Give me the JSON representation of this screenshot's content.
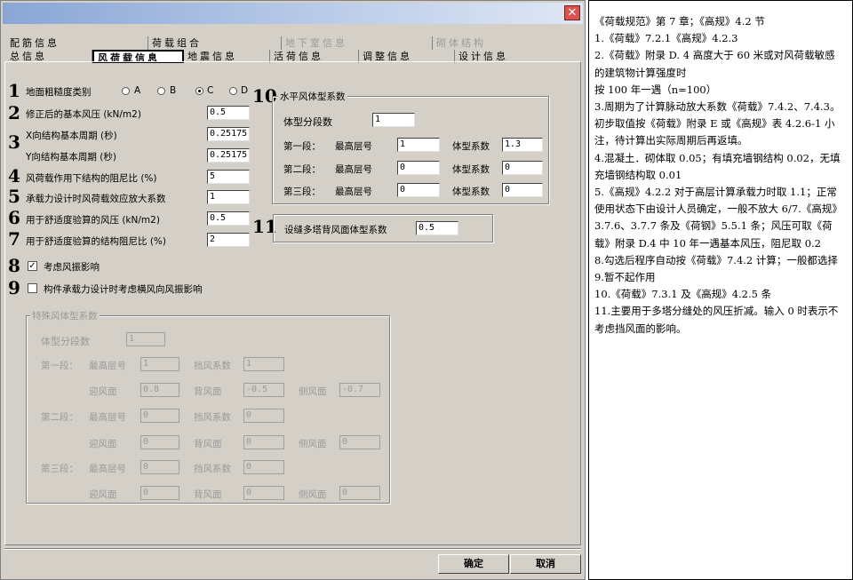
{
  "tabs_row1": [
    "配筋信息",
    "荷载组合",
    "地下室信息",
    "砌体结构"
  ],
  "tabs_row2": [
    "总信息",
    "风荷载信息",
    "地震信息",
    "活荷信息",
    "调整信息",
    "设计信息"
  ],
  "close_glyph": "✕",
  "markers": [
    "1",
    "2",
    "3",
    "4",
    "5",
    "6",
    "7",
    "8",
    "9",
    "10",
    "11"
  ],
  "fields": {
    "terrain_label": "地面粗糙度类别",
    "terrain_options": [
      "A",
      "B",
      "C",
      "D"
    ],
    "terrain_selected": "C",
    "pressure_label": "修正后的基本风压 (kN/m2)",
    "pressure": "0.5",
    "period_x_label": "X向结构基本周期 (秒)",
    "period_x": "0.25175",
    "period_y_label": "Y向结构基本周期 (秒)",
    "period_y": "0.25175",
    "damping_label": "风荷载作用下结构的阻尼比 (%)",
    "damping": "5",
    "amp_label": "承载力设计时风荷载效应放大系数",
    "amp": "1",
    "comfort_p_label": "用于舒适度验算的风压 (kN/m2)",
    "comfort_p": "0.5",
    "comfort_d_label": "用于舒适度验算的结构阻尼比 (%)",
    "comfort_d": "2",
    "chk8_label": "考虑风振影响",
    "chk8": "✓",
    "chk9_label": "构件承载力设计时考虑横风向风振影响"
  },
  "horizontal": {
    "title": "水平风体型系数",
    "segments_label": "体型分段数",
    "segments": "1",
    "max_floor_label": "最高层号",
    "coef_label": "体型系数",
    "rows": [
      {
        "label": "第一段：",
        "floor": "1",
        "coef": "1.3"
      },
      {
        "label": "第二段：",
        "floor": "0",
        "coef": "0"
      },
      {
        "label": "第三段：",
        "floor": "0",
        "coef": "0"
      }
    ]
  },
  "multi_tower": {
    "label": "设缝多塔背风面体型系数",
    "value": "0.5"
  },
  "special": {
    "title": "特殊风体型系数",
    "segments_label": "体型分段数",
    "segments": "1",
    "max_floor_label": "最高层号",
    "block_label": "挡风系数",
    "windward_label": "迎风面",
    "leeward_label": "背风面",
    "side_label": "侧风面",
    "rows": [
      {
        "label": "第一段：",
        "floor": "1",
        "block": "1",
        "windward": "0.8",
        "leeward": "-0.5",
        "side": "-0.7"
      },
      {
        "label": "第二段：",
        "floor": "0",
        "block": "0",
        "windward": "0",
        "leeward": "0",
        "side": "0"
      },
      {
        "label": "第三段：",
        "floor": "0",
        "block": "0",
        "windward": "0",
        "leeward": "0",
        "side": "0"
      }
    ]
  },
  "buttons": {
    "ok": "确定",
    "cancel": "取消"
  },
  "notes": [
    "《荷载规范》第 7 章；《高规》4.2 节",
    "1.《荷载》7.2.1《高规》4.2.3",
    "2.《荷载》附录 D. 4 高度大于 60 米或对风荷载敏感的建筑物计算强度时",
    "按 100 年一遇（n=100）",
    "3.周期为了计算脉动放大系数《荷载》7.4.2、7.4.3。初步取值按《荷载》附录 E 或《高规》表 4.2.6-1 小注，待计算出实际周期后再返填。",
    "4.混凝土．砌体取 0.05；有填充墙钢结构 0.02，无填充墙钢结构取 0.01",
    "5.《高规》4.2.2 对于高层计算承载力时取 1.1；正常使用状态下由设计人员确定，一般不放大 6/7.《高规》3.7.6、3.7.7 条及《荷钢》5.5.1 条；风压可取《荷载》附录 D.4 中 10 年一遇基本风压，阻尼取 0.2",
    "8.勾选后程序自动按《荷载》7.4.2 计算；一般都选择",
    "9.暂不起作用",
    "10.《荷载》7.3.1 及《高规》4.2.5 条",
    "11.主要用于多塔分缝处的风压折减。输入 0 时表示不考虑挡风面的影响。"
  ]
}
